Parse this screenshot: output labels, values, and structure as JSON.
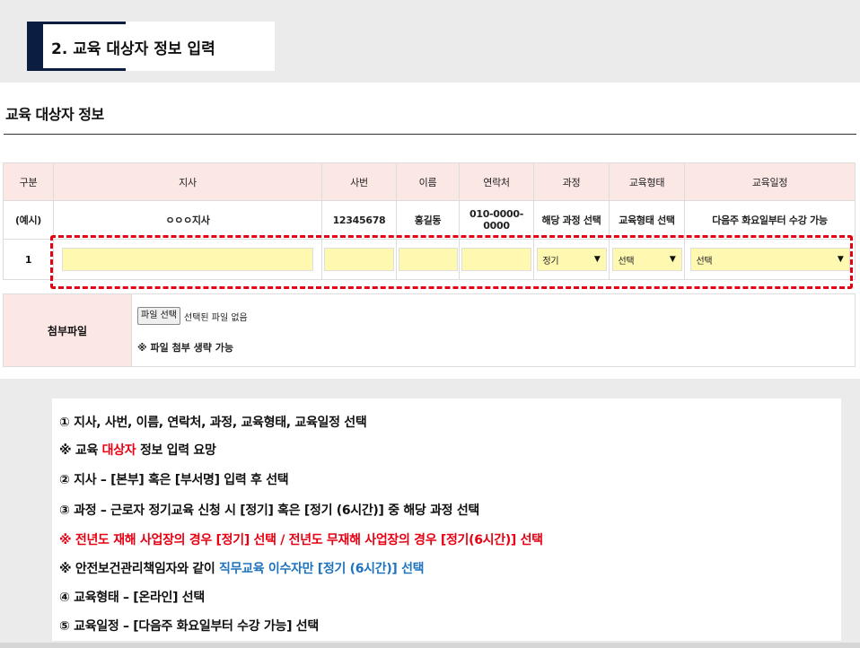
{
  "section_header": {
    "title": "2. 교육 대상자 정보 입력"
  },
  "form": {
    "title": "교육 대상자 정보",
    "columns": [
      "구분",
      "지사",
      "사번",
      "이름",
      "연락처",
      "과정",
      "교육형태",
      "교육일정"
    ],
    "example_row": [
      "(예시)",
      "ㅇㅇㅇ지사",
      "12345678",
      "홍길동",
      "010-0000-0000",
      "해당 과정 선택",
      "교육형태 선택",
      "다음주 화요일부터 수강 가능"
    ],
    "input_row": {
      "index": "1",
      "course_select": "정기",
      "type_select": "선택",
      "schedule_select": "선택"
    },
    "attachment": {
      "label": "첨부파일",
      "button": "파일 선택",
      "status": "선택된 파일 없음",
      "note": "※ 파일 첨부 생략 가능"
    }
  },
  "instructions": {
    "l1": "① 지사, 사번, 이름, 연락처, 과정, 교육형태, 교육일정 선택",
    "l2a": "※ 교육 ",
    "l2b": "대상자",
    "l2c": " 정보 입력 요망",
    "l3": "② 지사 – [본부] 혹은 [부서명] 입력 후 선택",
    "l4": "③ 과정 – 근로자 정기교육 신청 시 [정기] 혹은 [정기 (6시간)] 중 해당 과정 선택",
    "l5": "※ 전년도 재해 사업장의 경우 [정기] 선택 / 전년도 무재해 사업장의 경우 [정기(6시간)] 선택",
    "l6a": "※ 안전보건관리책임자와 같이 ",
    "l6b": "직무교육 이수자만 [정기 (6시간)] 선택",
    "l7": "④ 교육형태 –  [온라인] 선택",
    "l8": "⑤ 교육일정 –  [다음주 화요일부터 수강 가능] 선택"
  },
  "colors": {
    "accent_navy": "#0b1d40",
    "highlight_red": "#e60012",
    "link_blue": "#1e73be",
    "header_pink": "#fbe7e4",
    "input_yellow": "#fff8b0"
  }
}
